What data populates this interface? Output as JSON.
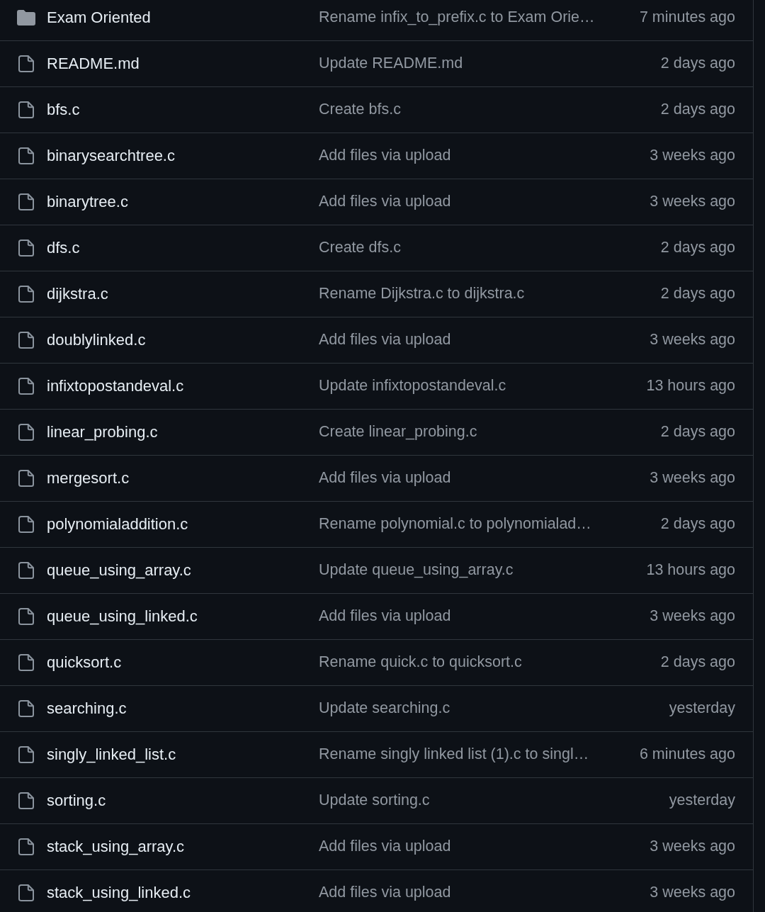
{
  "files": [
    {
      "kind": "folder",
      "name": "Exam Oriented",
      "message": "Rename infix_to_prefix.c to Exam Orie…",
      "time": "7 minutes ago"
    },
    {
      "kind": "file",
      "name": "README.md",
      "message": "Update README.md",
      "time": "2 days ago"
    },
    {
      "kind": "file",
      "name": "bfs.c",
      "message": "Create bfs.c",
      "time": "2 days ago"
    },
    {
      "kind": "file",
      "name": "binarysearchtree.c",
      "message": "Add files via upload",
      "time": "3 weeks ago"
    },
    {
      "kind": "file",
      "name": "binarytree.c",
      "message": "Add files via upload",
      "time": "3 weeks ago"
    },
    {
      "kind": "file",
      "name": "dfs.c",
      "message": "Create dfs.c",
      "time": "2 days ago"
    },
    {
      "kind": "file",
      "name": "dijkstra.c",
      "message": "Rename Dijkstra.c to dijkstra.c",
      "time": "2 days ago"
    },
    {
      "kind": "file",
      "name": "doublylinked.c",
      "message": "Add files via upload",
      "time": "3 weeks ago"
    },
    {
      "kind": "file",
      "name": "infixtopostandeval.c",
      "message": "Update infixtopostandeval.c",
      "time": "13 hours ago"
    },
    {
      "kind": "file",
      "name": "linear_probing.c",
      "message": "Create linear_probing.c",
      "time": "2 days ago"
    },
    {
      "kind": "file",
      "name": "mergesort.c",
      "message": "Add files via upload",
      "time": "3 weeks ago"
    },
    {
      "kind": "file",
      "name": "polynomialaddition.c",
      "message": "Rename polynomial.c to polynomialad…",
      "time": "2 days ago"
    },
    {
      "kind": "file",
      "name": "queue_using_array.c",
      "message": "Update queue_using_array.c",
      "time": "13 hours ago"
    },
    {
      "kind": "file",
      "name": "queue_using_linked.c",
      "message": "Add files via upload",
      "time": "3 weeks ago"
    },
    {
      "kind": "file",
      "name": "quicksort.c",
      "message": "Rename quick.c to quicksort.c",
      "time": "2 days ago"
    },
    {
      "kind": "file",
      "name": "searching.c",
      "message": "Update searching.c",
      "time": "yesterday"
    },
    {
      "kind": "file",
      "name": "singly_linked_list.c",
      "message": "Rename singly linked list (1).c to singl…",
      "time": "6 minutes ago"
    },
    {
      "kind": "file",
      "name": "sorting.c",
      "message": "Update sorting.c",
      "time": "yesterday"
    },
    {
      "kind": "file",
      "name": "stack_using_array.c",
      "message": "Add files via upload",
      "time": "3 weeks ago"
    },
    {
      "kind": "file",
      "name": "stack_using_linked.c",
      "message": "Add files via upload",
      "time": "3 weeks ago"
    }
  ]
}
